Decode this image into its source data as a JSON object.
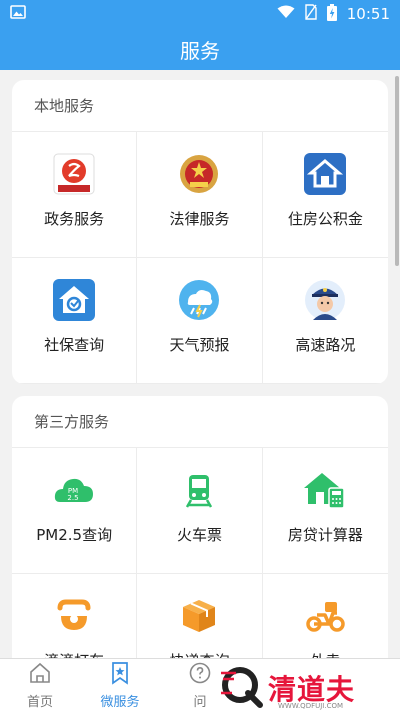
{
  "status_bar": {
    "time": "10:51"
  },
  "header": {
    "title": "服务"
  },
  "local_section": {
    "title": "本地服务",
    "items": [
      {
        "label": "政务服务",
        "icon": "government-service-icon"
      },
      {
        "label": "法律服务",
        "icon": "court-emblem-icon"
      },
      {
        "label": "住房公积金",
        "icon": "house-fund-icon"
      },
      {
        "label": "社保查询",
        "icon": "social-security-icon"
      },
      {
        "label": "天气预报",
        "icon": "weather-icon"
      },
      {
        "label": "高速路况",
        "icon": "traffic-police-icon"
      }
    ]
  },
  "third_party_section": {
    "title": "第三方服务",
    "items": [
      {
        "label": "PM2.5查询",
        "icon": "pm25-cloud-icon"
      },
      {
        "label": "火车票",
        "icon": "train-icon"
      },
      {
        "label": "房贷计算器",
        "icon": "house-calculator-icon"
      },
      {
        "label": "滴滴打车",
        "icon": "didi-icon"
      },
      {
        "label": "快递查询",
        "icon": "package-icon"
      },
      {
        "label": "外卖",
        "icon": "scooter-icon"
      }
    ]
  },
  "icons_text": {
    "pm25": "PM 2.5"
  },
  "bottom_nav": {
    "items": [
      {
        "label": "首页",
        "icon": "home-icon",
        "active": false
      },
      {
        "label": "微服务",
        "icon": "bookmark-icon",
        "active": true
      },
      {
        "label": "问",
        "icon": "question-icon",
        "active": false
      }
    ]
  },
  "watermark": {
    "text": "清道夫",
    "url": "WWW.QDFUJI.COM"
  },
  "colors": {
    "primary": "#3aa0f0",
    "nav_active": "#3a8fe0",
    "green": "#2fbf6b",
    "orange": "#f59a2a",
    "watermark": "#e6163b"
  }
}
